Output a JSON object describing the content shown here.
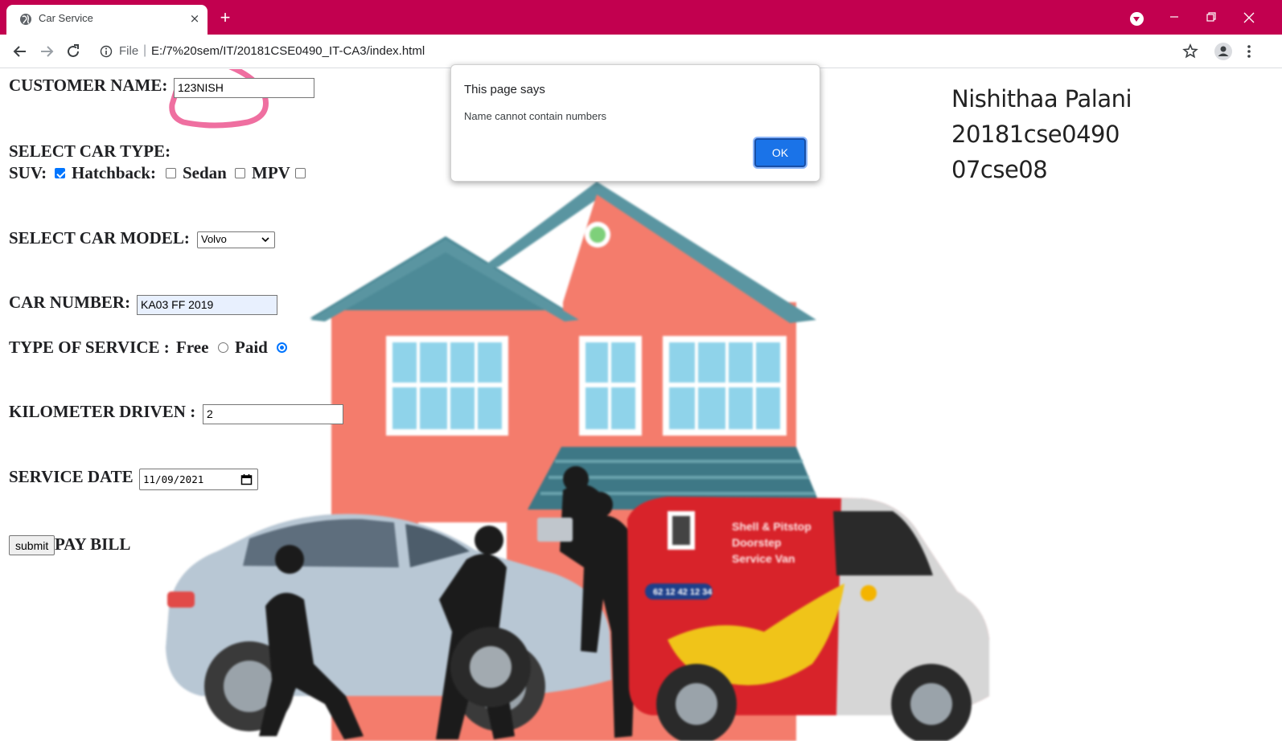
{
  "browser": {
    "tab_title": "Car Service",
    "new_tab_glyph": "+",
    "tab_close_glyph": "×",
    "omnibox": {
      "scheme_label": "File",
      "separator": "|",
      "url": "E:/7%20sem/IT/20181CSE0490_IT-CA3/index.html"
    },
    "colors": {
      "tab_strip": "#c2004f"
    }
  },
  "form": {
    "customer_name": {
      "label": "CUSTOMER NAME:",
      "value": "123NISH"
    },
    "car_type": {
      "heading": "SELECT CAR TYPE:",
      "options": [
        {
          "label": "SUV:",
          "checked": true
        },
        {
          "label": "Hatchback:",
          "checked": false
        },
        {
          "label": "Sedan",
          "checked": false
        },
        {
          "label": "MPV",
          "checked": false
        }
      ]
    },
    "car_model": {
      "label": "SELECT CAR MODEL:",
      "selected": "Volvo"
    },
    "car_number": {
      "label": "CAR NUMBER:",
      "value": "KA03 FF 2019"
    },
    "service_type": {
      "label": "TYPE OF SERVICE :",
      "options": [
        {
          "label": "Free",
          "selected": false
        },
        {
          "label": "Paid",
          "selected": true
        }
      ]
    },
    "kilometer": {
      "label": "KILOMETER DRIVEN :",
      "value": "2"
    },
    "service_date": {
      "label": "SERVICE DATE",
      "value": "11/09/2021"
    },
    "submit_label": "submit",
    "pay_bill_label": "PAY BILL"
  },
  "student_info": {
    "name": "Nishithaa Palani",
    "roll": "20181cse0490",
    "section": "07cse08"
  },
  "van_text": {
    "line1": "Shell & Pitstop",
    "line2": "Doorstep",
    "line3": "Service Van",
    "phone": "62 12 42 12 34"
  },
  "alert": {
    "title": "This page says",
    "message": "Name cannot contain numbers",
    "ok_label": "OK"
  },
  "colors": {
    "accent": "#1a73e8",
    "checkbox_on": "#0075ff",
    "scribble": "#ef6fa0"
  }
}
